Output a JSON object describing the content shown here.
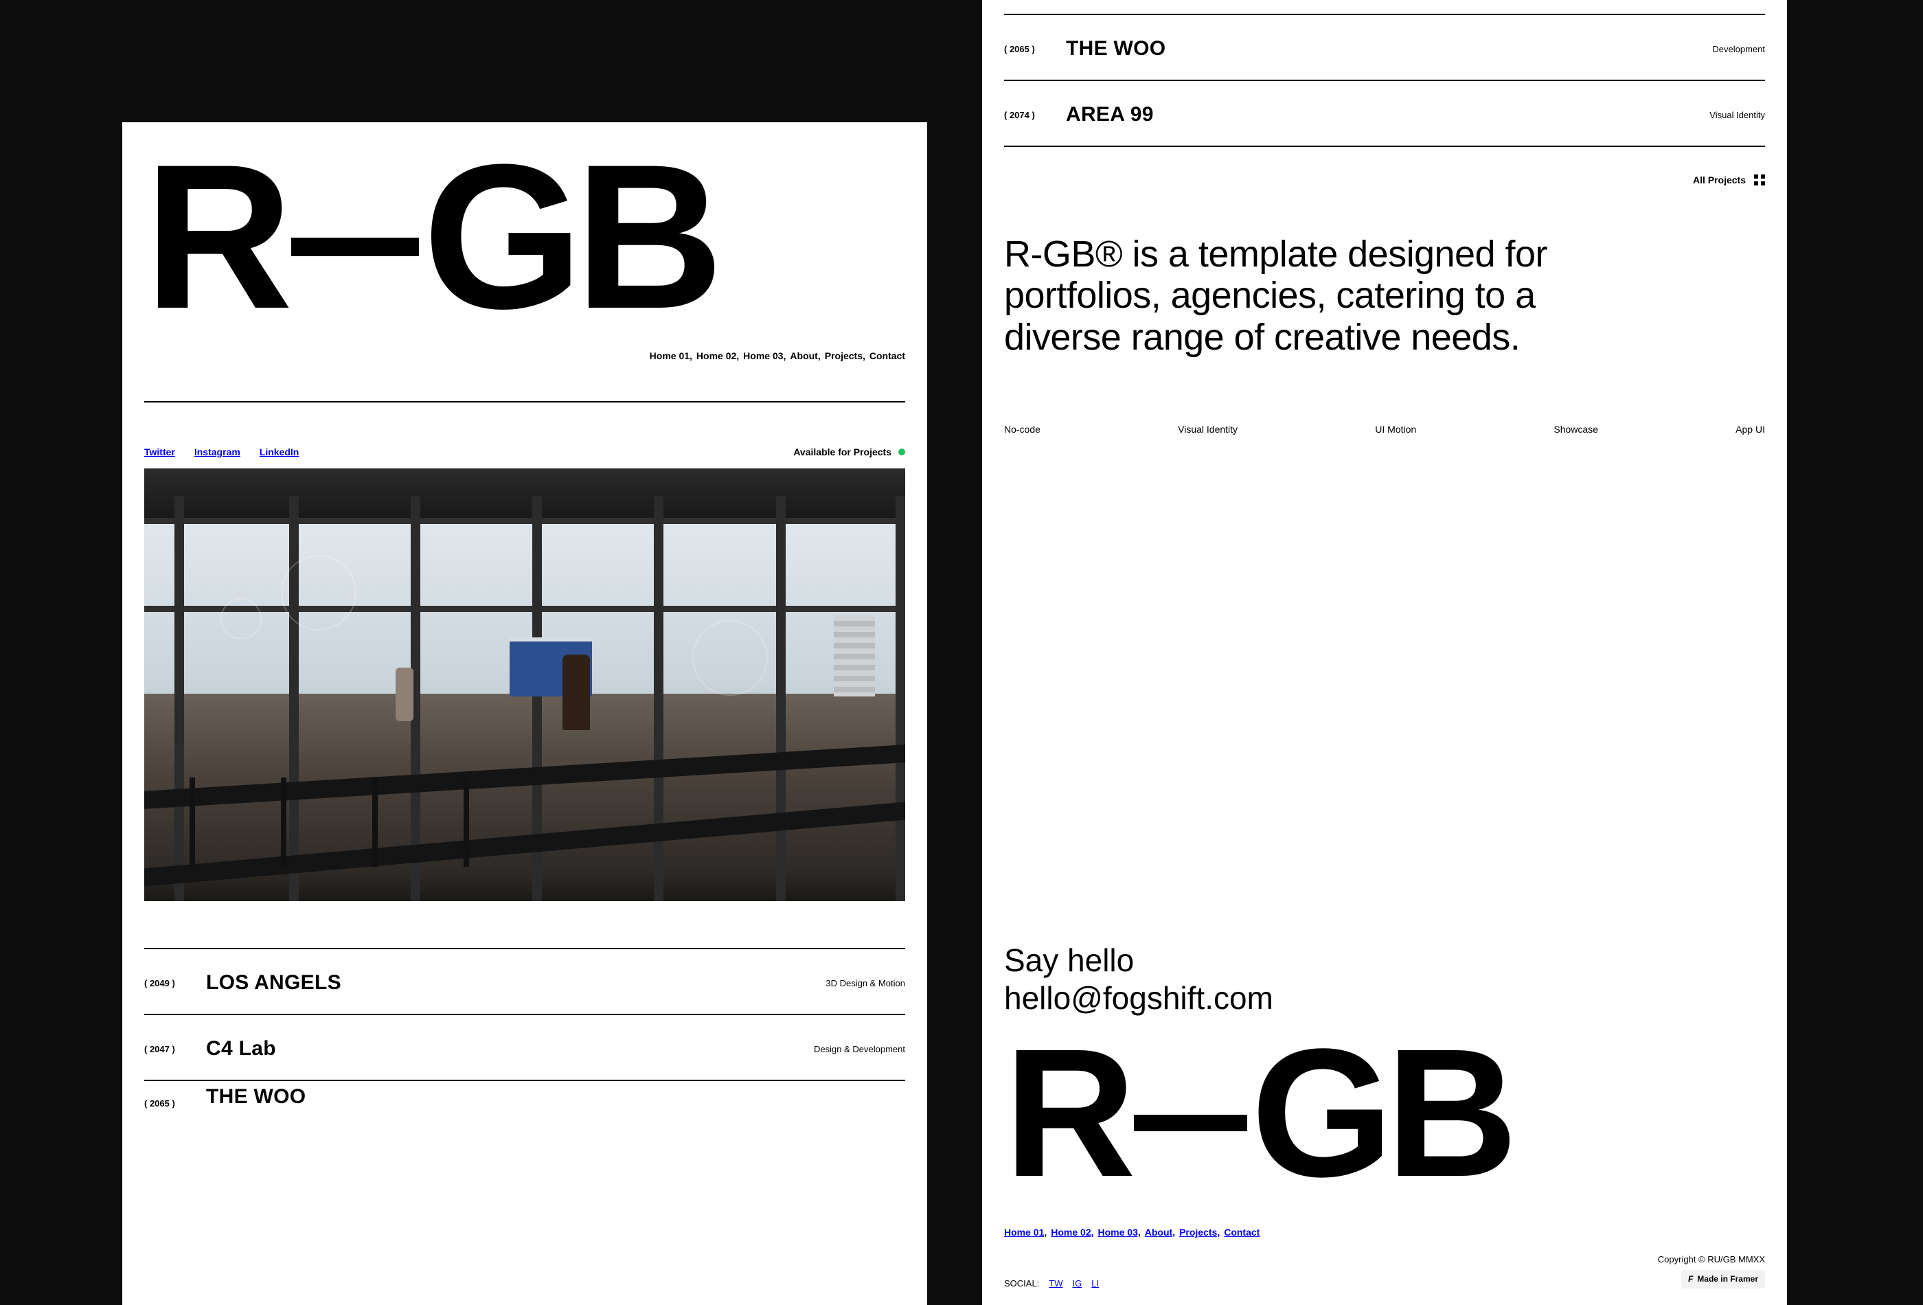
{
  "brand": {
    "r": "R",
    "gb": "GB"
  },
  "nav": [
    "Home 01,",
    "Home 02,",
    "Home 03,",
    "About,",
    "Projects,",
    "Contact"
  ],
  "social": {
    "twitter": "Twitter",
    "instagram": "Instagram",
    "linkedin": "LinkedIn"
  },
  "availability": "Available for Projects",
  "projects": [
    {
      "code": "( 2049 )",
      "title": "LOS ANGELS",
      "tag": "3D Design & Motion"
    },
    {
      "code": "( 2047 )",
      "title": "C4 Lab",
      "tag": "Design & Development"
    },
    {
      "code": "( 2065 )",
      "title": "THE WOO",
      "tag": "Development"
    },
    {
      "code": "( 2074 )",
      "title": "AREA 99",
      "tag": "Visual Identity"
    }
  ],
  "all_projects": "All Projects",
  "about": "R-GB® is a template designed for portfolios, agencies, catering to a diverse range of creative needs.",
  "tags": [
    "No-code",
    "Visual Identity",
    "UI Motion",
    "Showcase",
    "App UI"
  ],
  "contact": {
    "heading": "Say hello",
    "email": "hello@fogshift.com"
  },
  "footer": {
    "social_label": "SOCIAL:",
    "social_short": [
      "TW",
      "IG",
      "LI"
    ],
    "copyright": "Copyright © RU/GB MMXX",
    "framer": "Made in Framer"
  }
}
